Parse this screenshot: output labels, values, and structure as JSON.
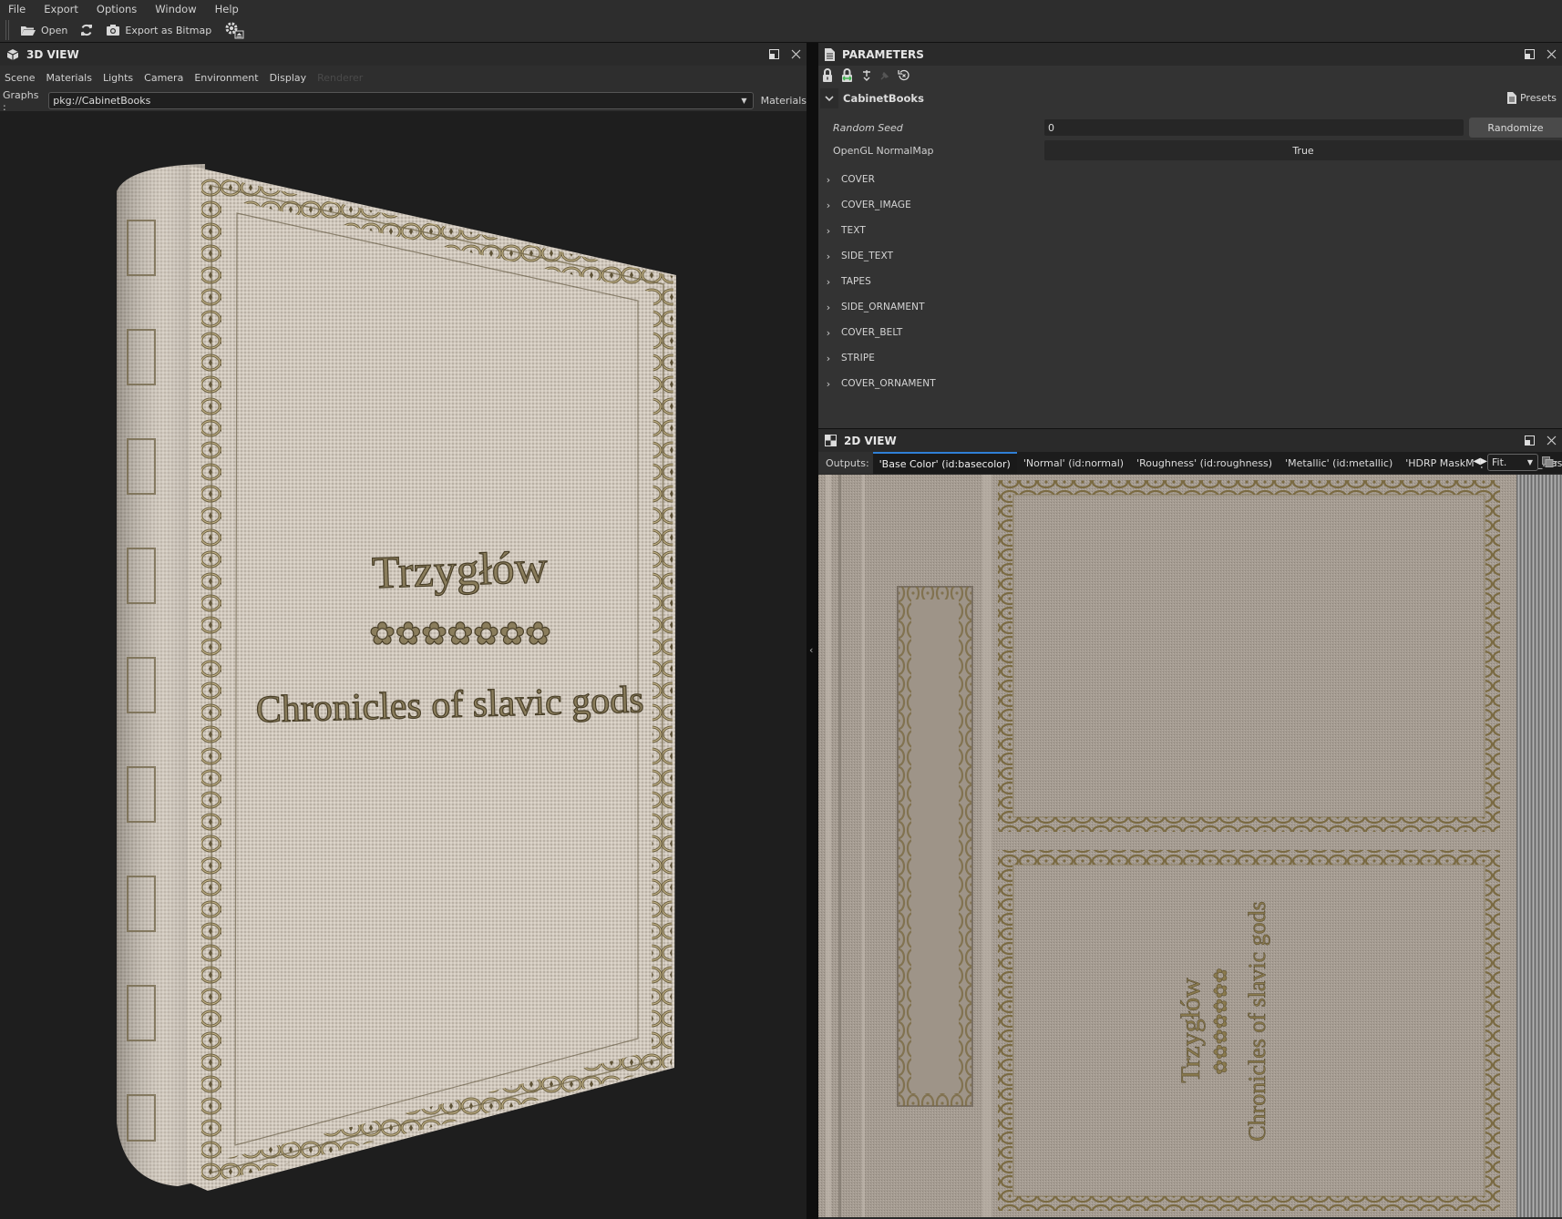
{
  "menubar": {
    "items": [
      "File",
      "Export",
      "Options",
      "Window",
      "Help"
    ]
  },
  "toolbar": {
    "open_label": "Open",
    "reload_icon": "refresh-icon",
    "export_label": "Export as Bitmap",
    "settings_icon": "gear-eject-icon"
  },
  "view3d": {
    "title": "3D VIEW",
    "menu": [
      "Scene",
      "Materials",
      "Lights",
      "Camera",
      "Environment",
      "Display"
    ],
    "menu_disabled": "Renderer",
    "graphs_label": "Graphs :",
    "graph_value": "pkg://CabinetBooks",
    "materials_label": "Materials",
    "book": {
      "title": "Trzygłów",
      "ornament": "✿✿✿✿✿✿✿",
      "subtitle": "Chronicles of slavic gods",
      "cloth_color": "#c9c0b4",
      "ornament_color": "#6e6244"
    }
  },
  "parameters": {
    "title": "PARAMETERS",
    "graph_name": "CabinetBooks",
    "presets_label": "Presets",
    "random_seed": {
      "label": "Random Seed",
      "value": "0",
      "button": "Randomize"
    },
    "opengl_normalmap": {
      "label": "OpenGL NormalMap",
      "value": "True"
    },
    "groups": [
      "COVER",
      "COVER_IMAGE",
      "TEXT",
      "SIDE_TEXT",
      "TAPES",
      "SIDE_ORNAMENT",
      "COVER_BELT",
      "STRIPE",
      "COVER_ORNAMENT"
    ]
  },
  "view2d": {
    "title": "2D VIEW",
    "outputs_label": "Outputs:",
    "outputs": [
      "'Base Color' (id:basecolor)",
      "'Normal' (id:normal)",
      "'Roughness' (id:roughness)",
      "'Metallic' (id:metallic)",
      "'HDRP MaskMap' (id:HDRP_MaskMa"
    ],
    "active_output": 0,
    "zoom_mode": "Fit.",
    "texture": {
      "title": "Trzygłów",
      "ornament": "✿✿✿✿✿✿✿",
      "subtitle": "Chronicles of slavic gods"
    }
  },
  "colors": {
    "accent": "#2f7fd6",
    "panel_bg": "#333333",
    "viewport_bg": "#1e1e1e",
    "lock_green": "#3fb34f"
  }
}
